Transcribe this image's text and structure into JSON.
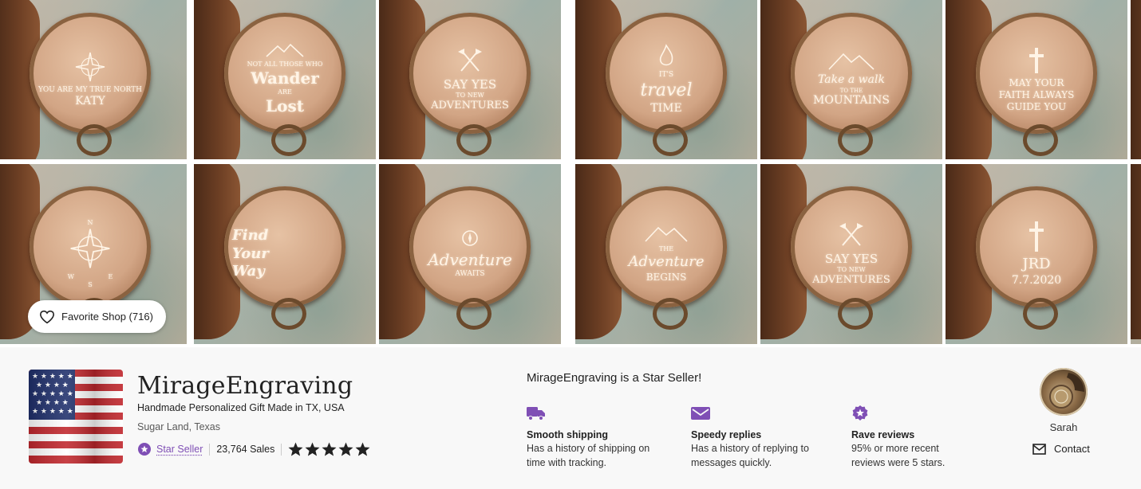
{
  "banner": {
    "tiles": [
      {
        "lines": [
          "YOU ARE MY TRUE NORTH",
          "KATY"
        ],
        "icon": "compass-rose-icon"
      },
      {
        "lines": [
          "NOT ALL THOSE WHO",
          "Wander",
          "ARE",
          "Lost"
        ],
        "icon": "mountain-icon"
      },
      {
        "lines": [
          "SAY YES",
          "TO NEW",
          "ADVENTURES"
        ],
        "icon": "crossed-axes-icon"
      },
      {
        "lines": [
          "IT'S",
          "travel",
          "TIME"
        ],
        "icon": "campfire-icon"
      },
      {
        "lines": [
          "Take a walk",
          "TO THE",
          "MOUNTAINS"
        ],
        "icon": "mountain-icon"
      },
      {
        "lines": [
          "MAY YOUR",
          "FAITH ALWAYS",
          "GUIDE YOU"
        ],
        "icon": "cross-icon"
      },
      {
        "lines": [
          "N",
          "W  E",
          "S"
        ],
        "icon": "compass-rose-icon"
      },
      {
        "lines": [
          "Find",
          "Your",
          "Way"
        ],
        "icon": "compass-icon"
      },
      {
        "lines": [
          "Adventure",
          "AWAITS"
        ],
        "icon": "compass-icon"
      },
      {
        "lines": [
          "THE",
          "Adventure",
          "BEGINS"
        ],
        "icon": "mountain-icon"
      },
      {
        "lines": [
          "SAY YES",
          "TO NEW",
          "ADVENTURES"
        ],
        "icon": "crossed-axes-icon"
      },
      {
        "lines": [
          "JRD",
          "7.7.2020"
        ],
        "icon": "cross-icon"
      }
    ]
  },
  "favorite": {
    "label": "Favorite Shop (716)",
    "icon": "heart-icon"
  },
  "shop": {
    "name": "MirageEngraving",
    "tagline": "Handmade Personalized Gift Made in TX, USA",
    "location": "Sugar Land, Texas",
    "star_seller_label": "Star Seller",
    "sales": "23,764 Sales",
    "rating_stars": 5,
    "logo_icon": "us-flag-icon"
  },
  "star_seller": {
    "title": "MirageEngraving is a Star Seller!",
    "features": [
      {
        "icon": "delivery-truck-icon",
        "title": "Smooth shipping",
        "desc_line1": "Has a history of shipping on",
        "desc_line2": "time with tracking."
      },
      {
        "icon": "message-icon",
        "title": "Speedy replies",
        "desc_line1": "Has a history of replying to",
        "desc_line2": "messages quickly."
      },
      {
        "icon": "star-badge-icon",
        "title": "Rave reviews",
        "desc_line1": "95% or more recent",
        "desc_line2": "reviews were 5 stars."
      }
    ]
  },
  "owner": {
    "name": "Sarah",
    "contact_label": "Contact",
    "contact_icon": "mail-icon"
  },
  "colors": {
    "accent": "#7f4fb5",
    "text": "#222222",
    "background": "#f8f8f8"
  }
}
